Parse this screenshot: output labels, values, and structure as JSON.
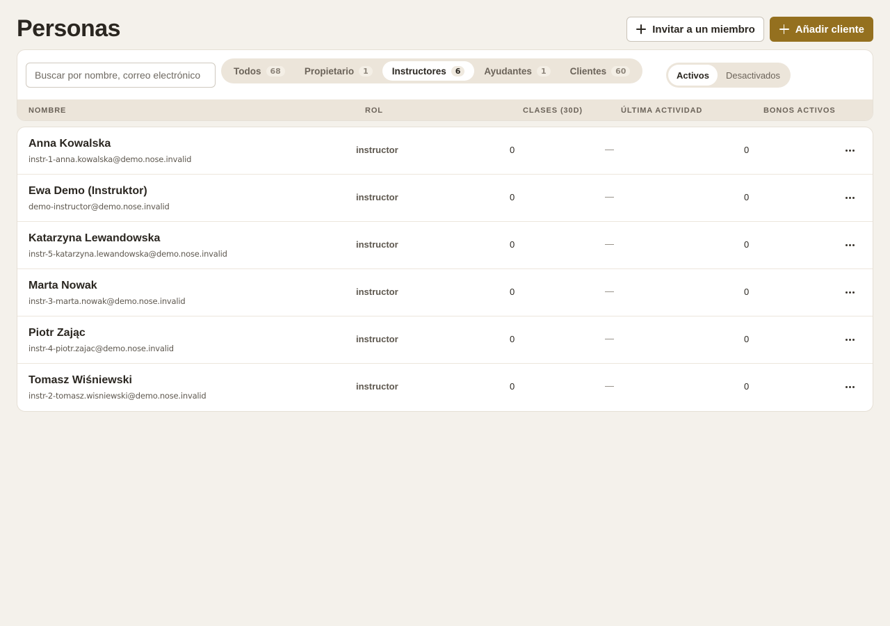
{
  "page": {
    "title": "Personas"
  },
  "actions": {
    "invite_label": "Invitar a un miembro",
    "add_client_label": "Añadir cliente"
  },
  "search": {
    "placeholder": "Buscar por nombre, correo electrónico"
  },
  "tabs": [
    {
      "label": "Todos",
      "count": "68",
      "active": false
    },
    {
      "label": "Propietario",
      "count": "1",
      "active": false
    },
    {
      "label": "Instructores",
      "count": "6",
      "active": true
    },
    {
      "label": "Ayudantes",
      "count": "1",
      "active": false
    },
    {
      "label": "Clientes",
      "count": "60",
      "active": false
    }
  ],
  "status_toggle": {
    "active_label": "Activos",
    "inactive_label": "Desactivados",
    "selected": "Activos"
  },
  "table": {
    "columns": {
      "name": "NOMBRE",
      "role": "ROL",
      "classes": "CLASES (30D)",
      "last_activity": "ÚLTIMA ACTIVIDAD",
      "bonos": "BONOS ACTIVOS"
    },
    "rows": [
      {
        "name": "Anna Kowalska",
        "email": "instr-1-anna.kowalska@demo.nose.invalid",
        "role": "instructor",
        "classes": "0",
        "last_activity": "—",
        "bonos": "0"
      },
      {
        "name": "Ewa Demo (Instruktor)",
        "email": "demo-instructor@demo.nose.invalid",
        "role": "instructor",
        "classes": "0",
        "last_activity": "—",
        "bonos": "0"
      },
      {
        "name": "Katarzyna Lewandowska",
        "email": "instr-5-katarzyna.lewandowska@demo.nose.invalid",
        "role": "instructor",
        "classes": "0",
        "last_activity": "—",
        "bonos": "0"
      },
      {
        "name": "Marta Nowak",
        "email": "instr-3-marta.nowak@demo.nose.invalid",
        "role": "instructor",
        "classes": "0",
        "last_activity": "—",
        "bonos": "0"
      },
      {
        "name": "Piotr Zając",
        "email": "instr-4-piotr.zajac@demo.nose.invalid",
        "role": "instructor",
        "classes": "0",
        "last_activity": "—",
        "bonos": "0"
      },
      {
        "name": "Tomasz Wiśniewski",
        "email": "instr-2-tomasz.wisniewski@demo.nose.invalid",
        "role": "instructor",
        "classes": "0",
        "last_activity": "—",
        "bonos": "0"
      }
    ]
  },
  "colors": {
    "background": "#f4f1eb",
    "accent": "#94701f",
    "tab_track": "#ece5da"
  },
  "icons": {
    "add": "plus-icon",
    "row_menu": "more-horizontal-icon"
  }
}
